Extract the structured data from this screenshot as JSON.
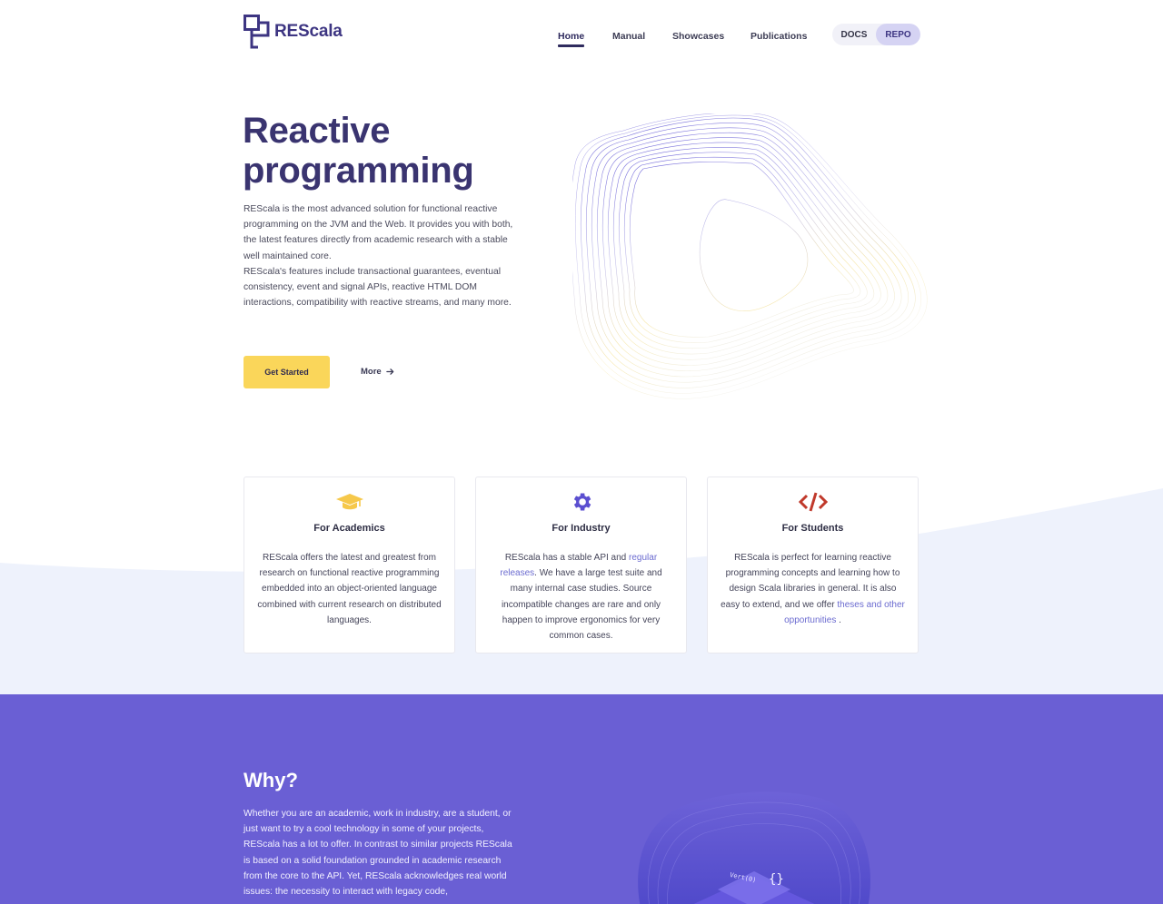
{
  "header": {
    "logo_text": "REScala",
    "nav": [
      {
        "label": "Home",
        "active": true
      },
      {
        "label": "Manual"
      },
      {
        "label": "Showcases"
      },
      {
        "label": "Publications"
      }
    ],
    "docs_label": "DOCS",
    "repo_label": "REPO"
  },
  "hero": {
    "title_line1": "Reactive",
    "title_line2": "programming",
    "paragraph1": "REScala is the most advanced solution for functional reactive programming on the JVM and the Web. It provides you with both, the latest features directly from academic research with a stable well maintained core.",
    "paragraph2": "REScala's features include transactional guarantees, eventual consistency, event and signal APIs, reactive HTML DOM interactions, compatibility with reactive streams, and many more.",
    "get_started_label": "Get Started",
    "more_label": "More",
    "more_icon": "arrow-right-icon"
  },
  "features": [
    {
      "icon": "graduation-cap-icon",
      "icon_color": "#f6c84a",
      "title": "For Academics",
      "text": "REScala offers the latest and greatest from research on functional reactive programming embedded into an object-oriented language combined with current research on distributed languages."
    },
    {
      "icon": "gear-icon",
      "icon_color": "#5b4fd0",
      "title": "For Industry",
      "text_before": "REScala has a stable API and ",
      "link": "regular releases",
      "text_after": ". We have a large test suite and many internal case studies. Source incompatible changes are rare and only happen to improve ergonomics for very common cases."
    },
    {
      "icon": "code-icon",
      "icon_color": "#c0392b",
      "title": "For Students",
      "text_before": "REScala is perfect for learning reactive programming concepts and learning how to design Scala libraries in general. It is also easy to extend, and we offer ",
      "link": "theses and other opportunities",
      "text_after": " ."
    }
  ],
  "why": {
    "title": "Why?",
    "text": "Whether you are an academic, work in industry, are a student, or just want to try a cool technology in some of your projects, REScala has a lot to offer. In contrast to similar projects REScala is based on a solid foundation grounded in academic research from the core to the API. Yet, REScala acknowledges real world issues: the necessity to interact with legacy code,",
    "art_code": "Vert(0)",
    "art_brace": "{}"
  },
  "colors": {
    "brand": "#3d3582",
    "accent_yellow": "#fad65a",
    "why_background": "#6a5fd4",
    "link": "#6b6bd0"
  }
}
